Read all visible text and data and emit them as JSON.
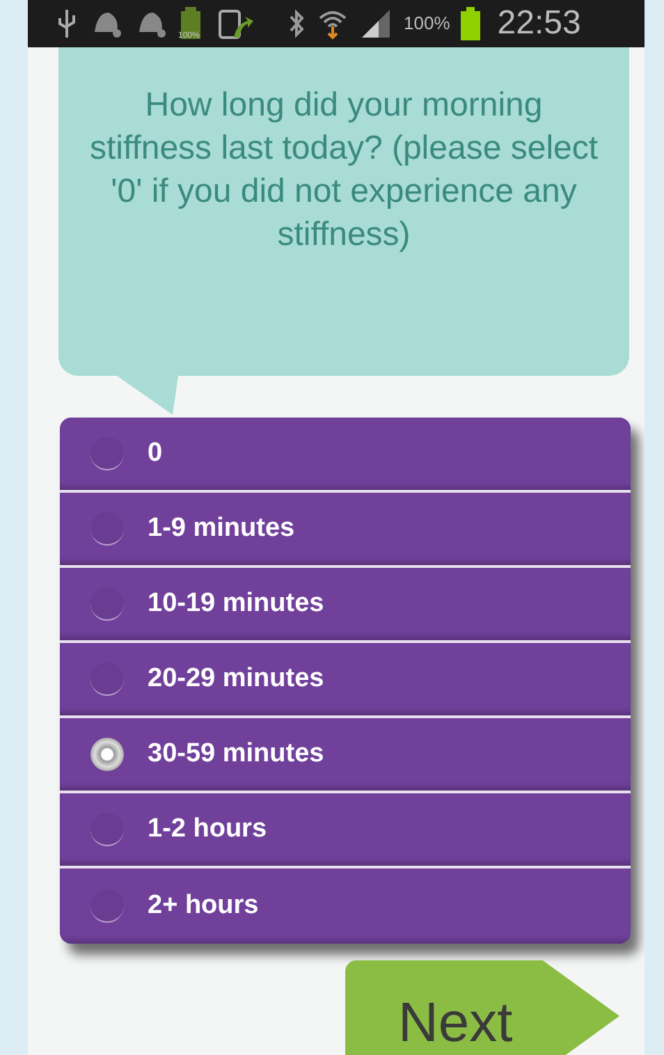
{
  "status_bar": {
    "notification_battery_label": "100%",
    "battery_percent": "100%",
    "time": "22:53"
  },
  "question": "How long did your morning stiffness last today? (please select '0' if you did not experience any stiffness)",
  "options": [
    {
      "label": "0",
      "selected": false
    },
    {
      "label": "1-9 minutes",
      "selected": false
    },
    {
      "label": "10-19 minutes",
      "selected": false
    },
    {
      "label": "20-29 minutes",
      "selected": false
    },
    {
      "label": "30-59 minutes",
      "selected": true
    },
    {
      "label": "1-2 hours",
      "selected": false
    },
    {
      "label": "2+ hours",
      "selected": false
    }
  ],
  "next_button": "Next"
}
